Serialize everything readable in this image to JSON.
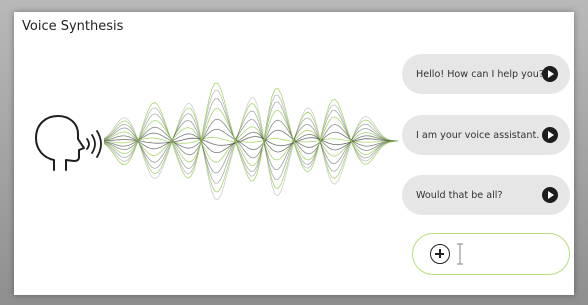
{
  "card": {
    "title": "Voice Synthesis"
  },
  "speaker": {
    "icon": "speaking-head-icon"
  },
  "waveform": {
    "accent_color": "#9fd35b",
    "line_color": "#3a3d42"
  },
  "messages": [
    {
      "text": "Hello! How can I help you?",
      "icon": "play-icon"
    },
    {
      "text": "I am your voice assistant.",
      "icon": "play-icon"
    },
    {
      "text": "Would that be all?",
      "icon": "play-icon"
    }
  ],
  "composer": {
    "add_icon": "plus-circle-icon",
    "cursor_icon": "text-cursor-icon",
    "value": "",
    "border_color": "#b7de7a"
  },
  "colors": {
    "bubble": "#e6e6e6",
    "play_button": "#1d1d1d"
  }
}
